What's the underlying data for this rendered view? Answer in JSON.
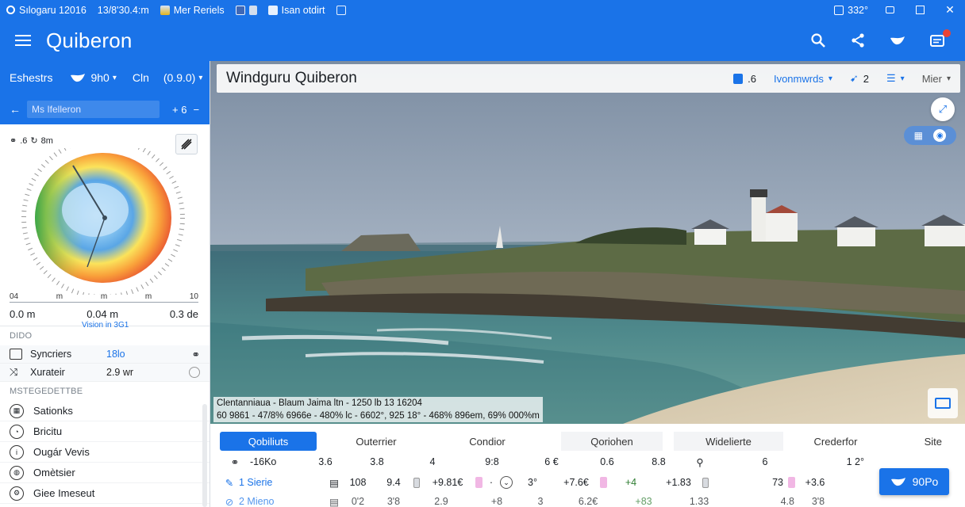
{
  "statusbar": {
    "items": [
      "Sılogaru 12016",
      "13/8'30.4:m",
      "Mer Reriels",
      "",
      "Isan otdirt",
      ""
    ],
    "right_value": "332°"
  },
  "appbar": {
    "title": "Quiberon"
  },
  "sidebar": {
    "header": {
      "label": "Eshestrs",
      "wind_value": "9h0",
      "unit": "Cln",
      "reading": "(0.9.0)",
      "location_placeholder": "Ms Ifelleron",
      "step_value": "+ 6",
      "step_minus": "−"
    },
    "rose": {
      "top_label": ".6",
      "top_unit": "8m",
      "axis": [
        "04",
        "m",
        "m",
        "m",
        "10"
      ],
      "left_value": "0.0 m",
      "center_value": "0.04 m",
      "right_value": "0.3 de",
      "center_sub": "Vision in 3G1"
    },
    "section1": "DIDO",
    "metrics": [
      {
        "name": "Syncriers",
        "value": "18lo",
        "end_icon": "goggles-icon"
      },
      {
        "name": "Xurateir",
        "value": "2.9 wr",
        "end_icon": "clock-icon"
      }
    ],
    "section2": "MSTEGEDETTBE",
    "menu": [
      {
        "icon": "grid-icon",
        "label": "Sationks"
      },
      {
        "icon": "gauge-icon",
        "label": "Bricitu"
      },
      {
        "icon": "info-icon",
        "label": "Ougár Vevis"
      },
      {
        "icon": "globe-icon",
        "label": "Omètsier"
      },
      {
        "icon": "settings-icon",
        "label": "Giee Imeseut"
      }
    ]
  },
  "main": {
    "title": "Windguru  Quiberon",
    "tb_count": ".6",
    "tb_dropdown": "Ivonmwrds",
    "tb_bird_count": "2",
    "tb_more": "Mier",
    "caption_line1": "Clentanniaua - Blaum Jaima ltn - 1250 lb 13 16204",
    "caption_line2": "60 9861 - 47/8% 6966e - 480% lc - 6602°, 925 18° - 468% 896em, 69% 000%m"
  },
  "table": {
    "headers": [
      "Qobiliuts",
      "Outerrier",
      "Condior",
      "Qoriohen",
      "Widelierte",
      "Crederfor",
      "Site"
    ],
    "rows": [
      [
        "-16Ko",
        "3.6",
        "3.8",
        "4",
        "9:8",
        "6 €",
        "0.6",
        "8.8",
        "",
        "6",
        "1 2°"
      ],
      [
        "1 Sierie",
        "108",
        "9.4",
        "+9.81€",
        "·",
        "3°",
        "+7.6€",
        "+4",
        "+1.83",
        "73",
        "+3.6"
      ],
      [
        "2 Mieno",
        "0'2",
        "3'8",
        "2.9",
        "+8",
        "3",
        "6.2€",
        "+83",
        "1.33",
        "4.8",
        "3'8"
      ]
    ],
    "share_label": "90Po"
  },
  "colors": {
    "primary": "#1a73e8",
    "accent_red": "#ea4335"
  }
}
